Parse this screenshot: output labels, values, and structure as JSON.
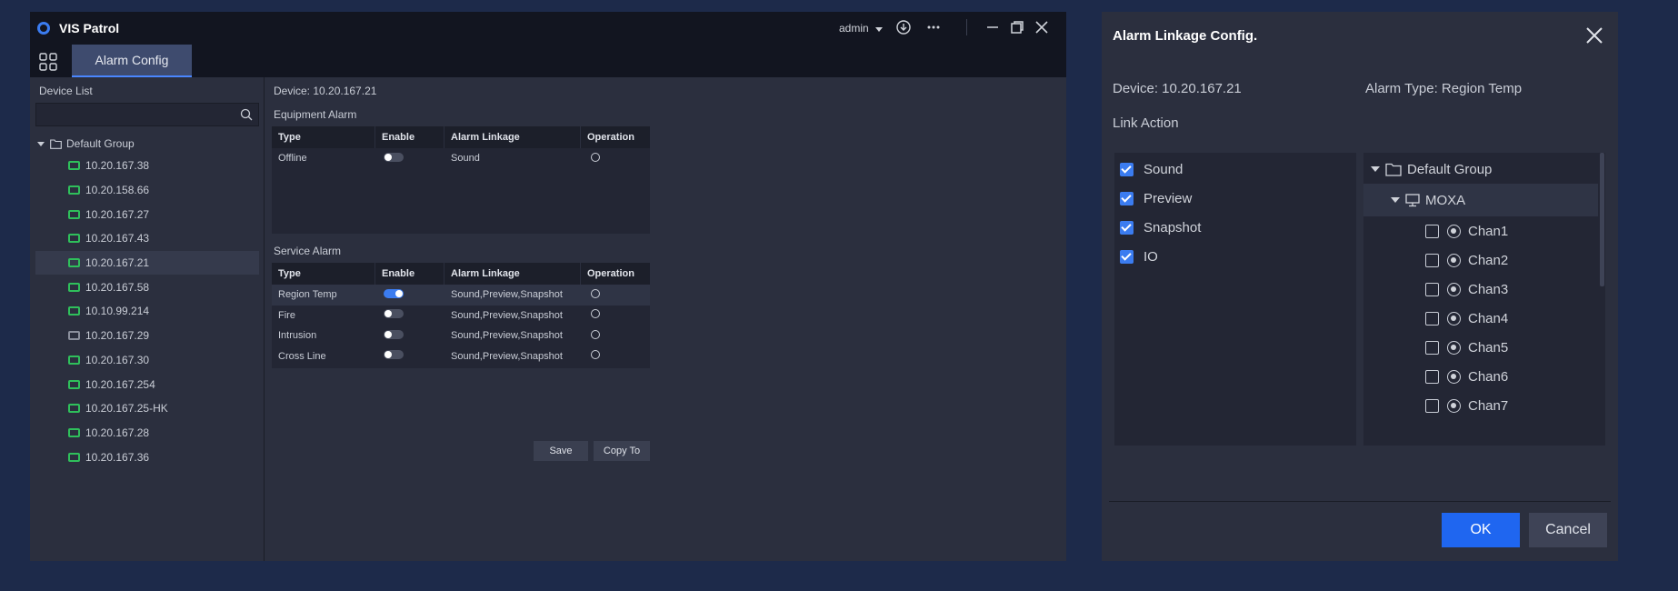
{
  "app": {
    "title": "VIS Patrol",
    "user": "admin",
    "tab_label": "Alarm Config"
  },
  "sidebar": {
    "title": "Device List",
    "search_placeholder": "",
    "group": "Default Group",
    "devices": [
      {
        "label": "10.20.167.38",
        "online": true
      },
      {
        "label": "10.20.158.66",
        "online": true
      },
      {
        "label": "10.20.167.27",
        "online": true
      },
      {
        "label": "10.20.167.43",
        "online": true
      },
      {
        "label": "10.20.167.21",
        "online": true,
        "selected": true
      },
      {
        "label": "10.20.167.58",
        "online": true
      },
      {
        "label": "10.10.99.214",
        "online": true
      },
      {
        "label": "10.20.167.29",
        "online": false
      },
      {
        "label": "10.20.167.30",
        "online": true
      },
      {
        "label": "10.20.167.254",
        "online": true
      },
      {
        "label": "10.20.167.25-HK",
        "online": true
      },
      {
        "label": "10.20.167.28",
        "online": true
      },
      {
        "label": "10.20.167.36",
        "online": true
      }
    ]
  },
  "content": {
    "device": "Device: 10.20.167.21",
    "equipment_title": "Equipment Alarm",
    "service_title": "Service Alarm",
    "headers": {
      "type": "Type",
      "enable": "Enable",
      "linkage": "Alarm Linkage",
      "operation": "Operation"
    },
    "equipment_rows": [
      {
        "type": "Offline",
        "enabled": false,
        "linkage": "Sound"
      }
    ],
    "service_rows": [
      {
        "type": "Region Temp",
        "enabled": true,
        "linkage": "Sound,Preview,Snapshot"
      },
      {
        "type": "Fire",
        "enabled": false,
        "linkage": "Sound,Preview,Snapshot"
      },
      {
        "type": "Intrusion",
        "enabled": false,
        "linkage": "Sound,Preview,Snapshot"
      },
      {
        "type": "Cross Line",
        "enabled": false,
        "linkage": "Sound,Preview,Snapshot"
      }
    ],
    "save_label": "Save",
    "copy_label": "Copy To"
  },
  "dialog": {
    "title": "Alarm Linkage Config.",
    "device": "Device: 10.20.167.21",
    "alarm_type": "Alarm Type: Region Temp",
    "link_action_label": "Link Action",
    "actions": [
      {
        "label": "Sound",
        "checked": true
      },
      {
        "label": "Preview",
        "checked": true
      },
      {
        "label": "Snapshot",
        "checked": true
      },
      {
        "label": "IO",
        "checked": true
      }
    ],
    "tree_group": "Default Group",
    "tree_device": "MOXA",
    "channels": [
      "Chan1",
      "Chan2",
      "Chan3",
      "Chan4",
      "Chan5",
      "Chan6",
      "Chan7"
    ],
    "ok_label": "OK",
    "cancel_label": "Cancel"
  },
  "colors": {
    "accent": "#1f66f0",
    "online": "#2fbf5b",
    "background": "#1d2a4a"
  }
}
